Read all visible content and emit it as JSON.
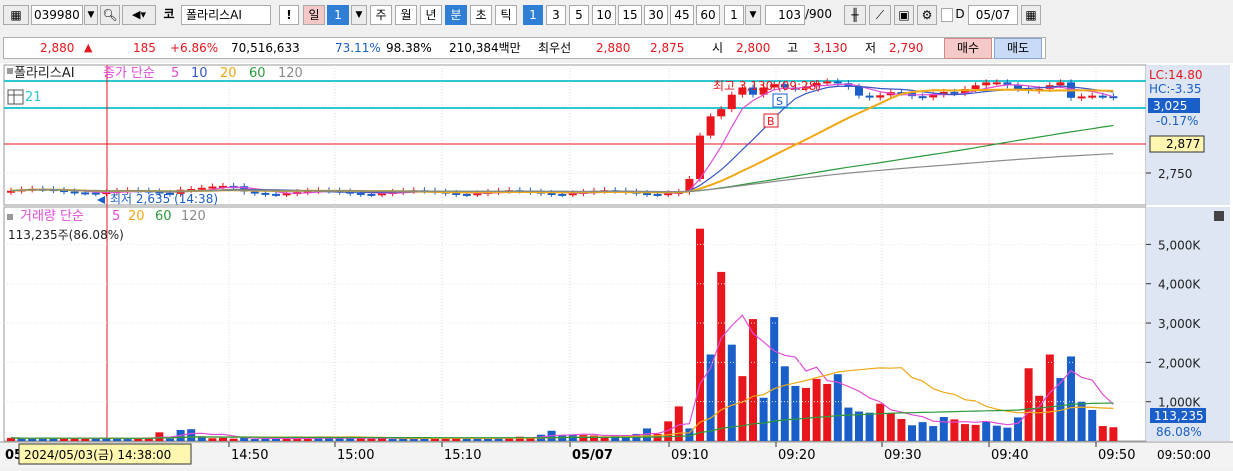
{
  "toolbar": {
    "code": "039980",
    "market_badge": "코",
    "stock_name": "폴라리스AI",
    "warning": "!",
    "periods": [
      "일",
      "1",
      "주",
      "월",
      "년",
      "분",
      "초",
      "틱"
    ],
    "minute_options": [
      "1",
      "3",
      "5",
      "10",
      "15",
      "30",
      "45",
      "60"
    ],
    "count_value": "1",
    "display_count": "103",
    "total_count": "/900",
    "date_value": "05/07",
    "date_checkbox_label": "D"
  },
  "infobar": {
    "price": "2,880",
    "change": "185",
    "change_pct": "+6.86%",
    "volume": "70,516,633",
    "vol_ratio": "73.11%",
    "power": "98.38%",
    "amount": "210,384백만",
    "best_ask_label": "최우선",
    "best_ask": "2,880",
    "best_bid": "2,875",
    "open_label": "시",
    "open": "2,800",
    "high_label": "고",
    "high": "3,130",
    "low_label": "저",
    "low": "2,790",
    "buy_label": "매수",
    "sell_label": "매도"
  },
  "price_panel": {
    "name": "폴라리스AI",
    "legend_label": "종가 단순",
    "ma_periods": [
      "5",
      "10",
      "20",
      "60",
      "120"
    ],
    "sub_label": "21",
    "high_annotation": "최고 3,130 (09:28)",
    "low_annotation": "최저 2,635 (14:38)",
    "lc_label": "LC:14.80",
    "hc_label": "HC:-3.35",
    "last_price_tag": "3,025",
    "last_pct": "-0.17%",
    "cursor_price_tag": "2,877",
    "axis_tick": "2,750",
    "signal_s": "S",
    "signal_b": "B"
  },
  "volume_panel": {
    "label": "거래량 단순",
    "ma_periods": [
      "5",
      "20",
      "60",
      "120"
    ],
    "value_text": "113,235주(86.08%)",
    "last_tag": "113,235",
    "last_pct": "86.08%",
    "axis_ticks": [
      "5,000K",
      "4,000K",
      "3,000K",
      "2,000K",
      "1,000K"
    ]
  },
  "time_axis": {
    "cursor_label": "2024/05/03(금) 14:38:00",
    "left_stub": "05",
    "labels": [
      "14:50",
      "15:00",
      "15:10",
      "05/07",
      "09:10",
      "09:20",
      "09:30",
      "09:40",
      "09:50"
    ],
    "right_label": "09:50:00"
  },
  "colors": {
    "up": "#e8161c",
    "down": "#1a5fc9",
    "ma5": "#e24bd8",
    "ma10": "#3956c8",
    "ma20": "#f0a814",
    "ma60": "#2a9a3a",
    "ma120": "#8a8a8a",
    "cyan": "#2cc7d1"
  },
  "chart_data": {
    "type": "bar",
    "title": "",
    "x_labels": [
      "14:50",
      "15:00",
      "15:10",
      "05/07",
      "09:10",
      "09:20",
      "09:30",
      "09:40",
      "09:50"
    ],
    "price_axis_tick": 2750,
    "volume_axis_ticks_k": [
      1000,
      2000,
      3000,
      4000,
      5000
    ],
    "high": {
      "value": 3130,
      "time": "09:28"
    },
    "low": {
      "value": 2635,
      "time": "14:38"
    },
    "last_price": 3025,
    "volume_series_k": [
      80,
      70,
      60,
      90,
      70,
      60,
      75,
      55,
      70,
      80,
      60,
      50,
      65,
      90,
      220,
      60,
      280,
      300,
      120,
      70,
      80,
      60,
      95,
      50,
      60,
      70,
      55,
      80,
      60,
      90,
      65,
      70,
      85,
      75,
      60,
      70,
      50,
      80,
      60,
      70,
      65,
      85,
      70,
      60,
      75,
      55,
      90,
      80,
      110,
      70,
      160,
      260,
      140,
      160,
      150,
      140,
      110,
      140,
      150,
      180,
      320,
      180,
      500,
      880,
      320,
      5400,
      2200,
      4300,
      2450,
      1650,
      3100,
      1100,
      3150,
      1900,
      1400,
      1350,
      1580,
      1450,
      1700,
      850,
      750,
      720,
      950,
      700,
      560,
      400,
      480,
      380,
      610,
      550,
      430,
      410,
      500,
      390,
      340,
      600,
      1850,
      1150,
      2200,
      1600,
      2150,
      1000,
      790,
      380,
      350
    ]
  }
}
